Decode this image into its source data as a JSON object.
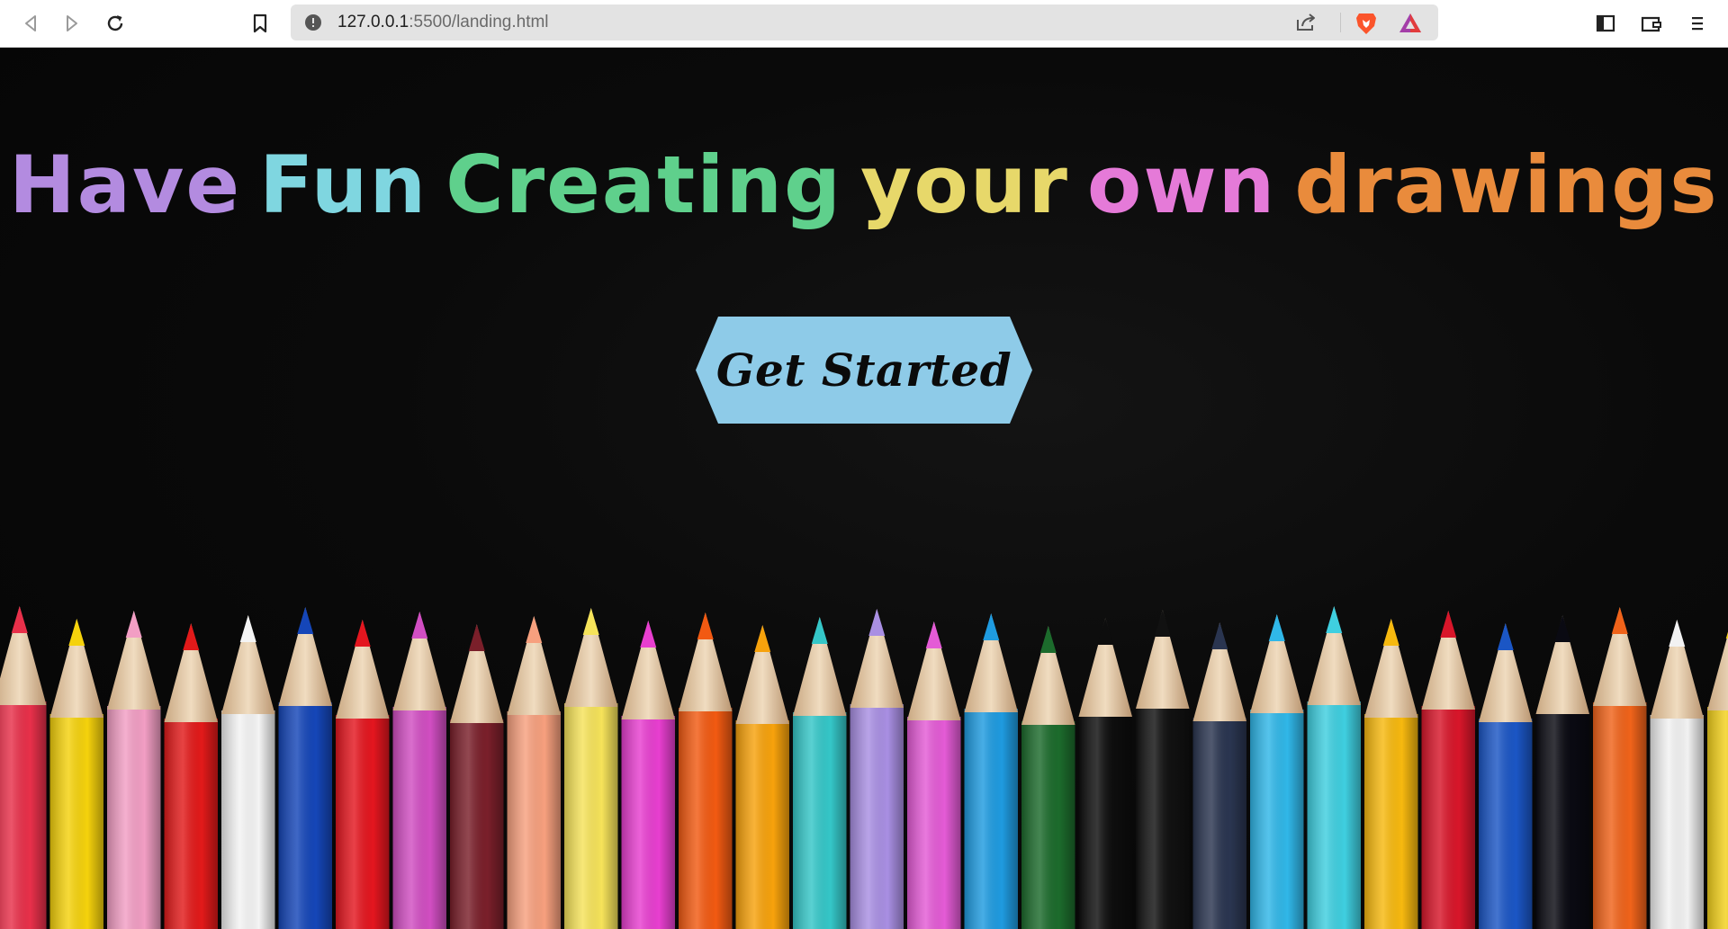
{
  "browser": {
    "url_host": "127.0.0.1",
    "url_path": ":5500/landing.html",
    "icons": {
      "back": "back-arrow-icon",
      "forward": "forward-arrow-icon",
      "reload": "reload-icon",
      "bookmark": "bookmark-icon",
      "site_info": "info-icon",
      "share": "share-icon",
      "brave_shields": "brave-lion-icon",
      "rewards": "brave-rewards-triangle-icon",
      "sidebar": "sidebar-icon",
      "wallet": "wallet-icon",
      "menu": "menu-icon"
    }
  },
  "hero": {
    "headline_words": [
      {
        "text": "Have",
        "color": "#b38be0"
      },
      {
        "text": "Fun",
        "color": "#7fd6e0"
      },
      {
        "text": "Creating",
        "color": "#5fd08c"
      },
      {
        "text": "your",
        "color": "#e7d86a"
      },
      {
        "text": "own",
        "color": "#e57ad8"
      },
      {
        "text": "drawings!",
        "color": "#e98b3c"
      }
    ],
    "cta_label": "Get Started",
    "cta_color": "#8ecbe8",
    "background_image": "colored-pencils-photo"
  }
}
